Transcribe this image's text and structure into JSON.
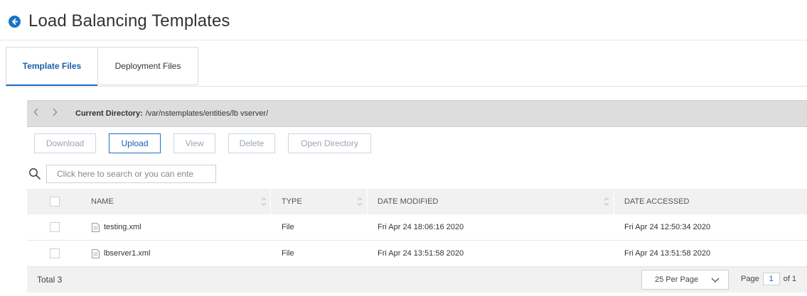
{
  "header": {
    "title": "Load Balancing Templates"
  },
  "tabs": [
    {
      "label": "Template Files",
      "active": true
    },
    {
      "label": "Deployment Files",
      "active": false
    }
  ],
  "directory": {
    "label": "Current Directory:",
    "path": "/var/nstemplates/entities/lb vserver/"
  },
  "toolbar": {
    "download": "Download",
    "upload": "Upload",
    "view": "View",
    "delete": "Delete",
    "open_directory": "Open Directory"
  },
  "search": {
    "placeholder": "Click here to search or you can ente"
  },
  "table": {
    "columns": {
      "name": "NAME",
      "type": "TYPE",
      "date_modified": "DATE MODIFIED",
      "date_accessed": "DATE ACCESSED"
    },
    "rows": [
      {
        "name": "testing.xml",
        "type": "File",
        "date_modified": "Fri Apr 24 18:06:16 2020",
        "date_accessed": "Fri Apr 24 12:50:34 2020"
      },
      {
        "name": "lbserver1.xml",
        "type": "File",
        "date_modified": "Fri Apr 24 13:51:58 2020",
        "date_accessed": "Fri Apr 24 13:51:58 2020"
      }
    ]
  },
  "footer": {
    "total": "Total 3",
    "per_page": "25 Per Page",
    "page_label": "Page",
    "page_value": "1",
    "of_label": "of 1"
  },
  "colors": {
    "accent": "#1a73c7",
    "header_bar": "#dddddd",
    "table_header": "#f1f1f1"
  },
  "icons": [
    "back-arrow-icon",
    "chevron-left-icon",
    "chevron-right-icon",
    "search-icon",
    "file-icon",
    "sort-icon",
    "chevron-down-icon"
  ]
}
